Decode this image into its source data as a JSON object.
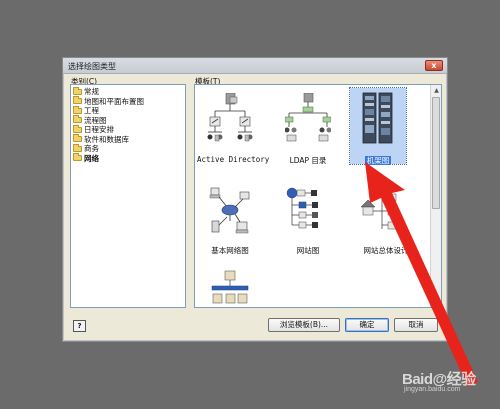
{
  "dialog": {
    "title": "选择绘图类型",
    "close": "x",
    "category_label": "类别(C)",
    "template_label": "模板(T)"
  },
  "categories": [
    {
      "label": "常规",
      "selected": false
    },
    {
      "label": "地图和平面布置图",
      "selected": false
    },
    {
      "label": "工程",
      "selected": false
    },
    {
      "label": "流程图",
      "selected": false
    },
    {
      "label": "日程安排",
      "selected": false
    },
    {
      "label": "软件和数据库",
      "selected": false
    },
    {
      "label": "商务",
      "selected": false
    },
    {
      "label": "网络",
      "selected": true
    }
  ],
  "templates": {
    "active_directory": "Active Directory",
    "ldap": "LDAP 目录",
    "rack": "机架图",
    "basic_network": "基本网络图",
    "network_diagram": "网站图",
    "website_master": "网站总体设计"
  },
  "buttons": {
    "help": "?",
    "browse": "浏览模板(B)...",
    "ok": "确定",
    "cancel": "取消"
  },
  "watermark": {
    "brand": "Baid@经验",
    "url": "jingyan.baidu.com"
  },
  "colors": {
    "arrow": "#e8231b",
    "selection": "#3c78d8",
    "background": "#6b6b6b"
  }
}
